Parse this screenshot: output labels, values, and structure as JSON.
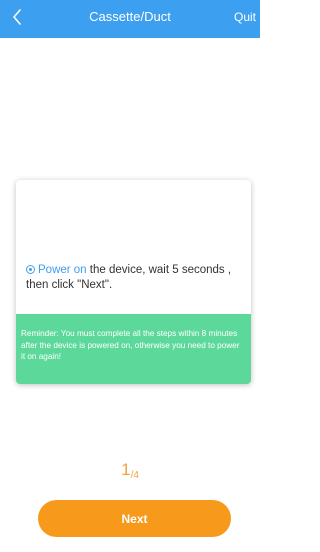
{
  "header": {
    "back_icon": "chevron-left-icon",
    "title": "Cassette/Duct",
    "quit_label": "Quit"
  },
  "card": {
    "step_highlight": "Power on",
    "step_text": " the device, wait 5 seconds , then click \"Next\".",
    "reminder": "Reminder: You must complete all the steps within 8 minutes after the device is powered on, otherwise you need to power it on again!"
  },
  "pagination": {
    "current": "1",
    "total": "4"
  },
  "next_label": "Next",
  "colors": {
    "header": "#3d9ff0",
    "accent": "#3d9ff0",
    "reminder_bg": "#5cd99a",
    "button": "#f79a1c",
    "page_indicator": "#f5a040"
  }
}
